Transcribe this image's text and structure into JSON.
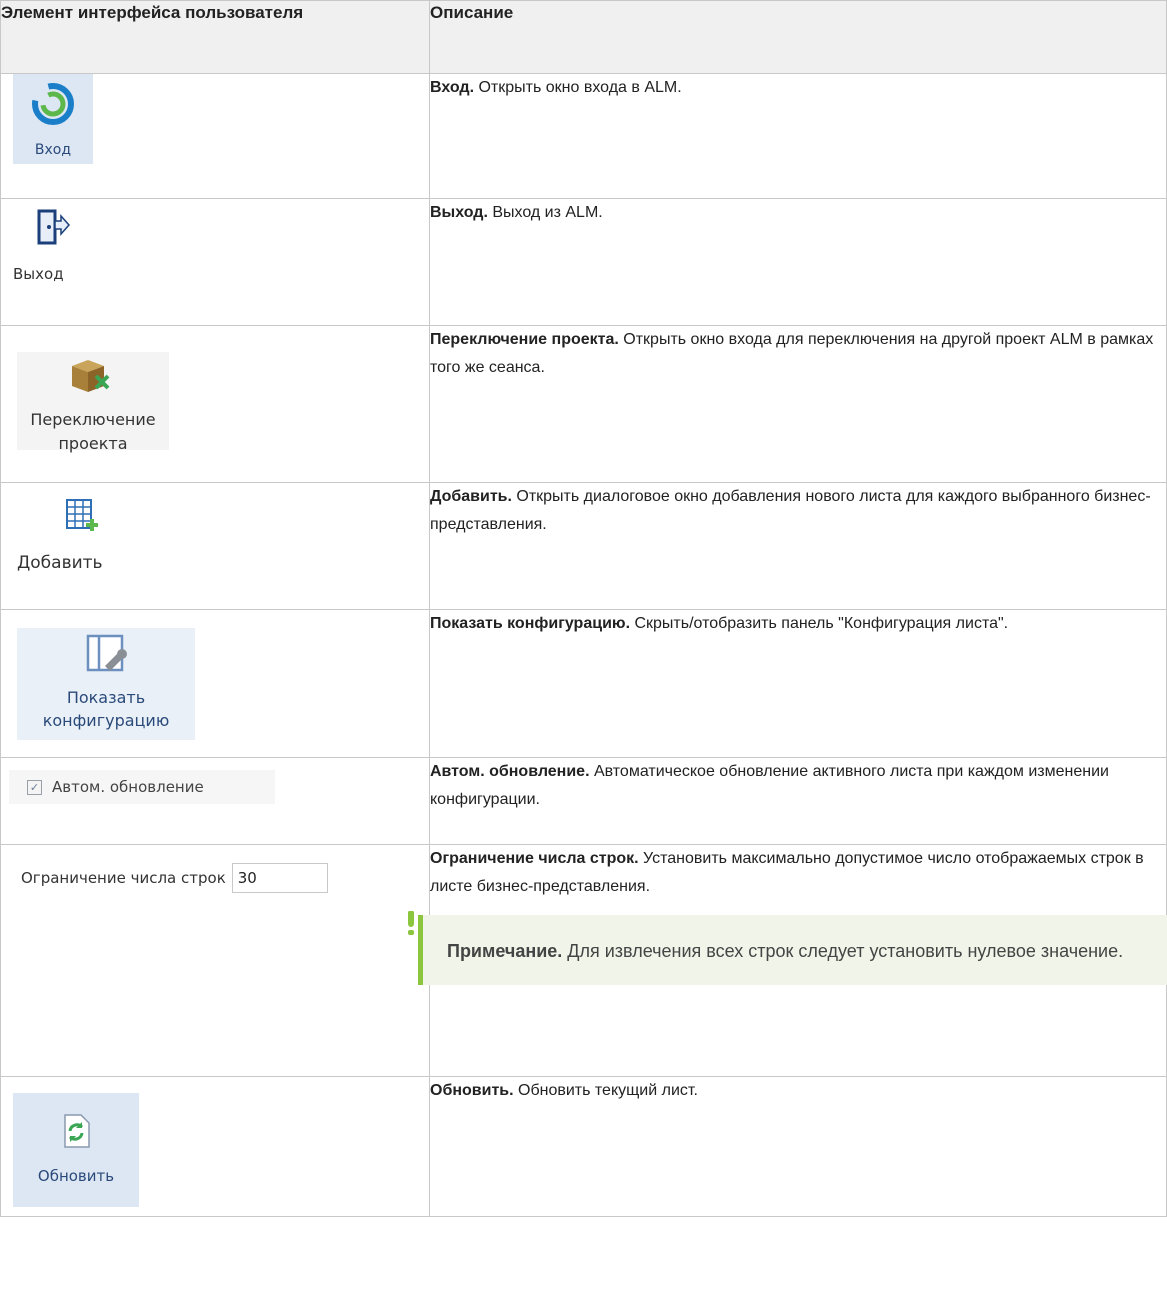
{
  "header": {
    "col1": "Элемент интерфейса пользователя",
    "col2": "Описание"
  },
  "rows": [
    {
      "icon_name": "alm-login-icon",
      "icon_label": "Вход",
      "title": "Вход.",
      "text": " Открыть окно входа в ALM."
    },
    {
      "icon_name": "logout-door-icon",
      "icon_label": "Выход",
      "title": "Выход.",
      "text": " Выход из ALM."
    },
    {
      "icon_name": "switch-project-box-icon",
      "icon_label": "Переключение проекта",
      "title": "Переключение проекта.",
      "text": " Открыть окно входа для переключения на другой проект ALM в рамках того же сеанса."
    },
    {
      "icon_name": "add-sheet-icon",
      "icon_label": "Добавить",
      "title": "Добавить.",
      "text": " Открыть диалоговое окно добавления нового листа для каждого выбранного бизнес-представления."
    },
    {
      "icon_name": "show-config-icon",
      "icon_label": "Показать конфигурацию",
      "title": "Показать конфигурацию.",
      "text": " Скрыть/отобразить панель \"Конфигурация листа\"."
    },
    {
      "icon_name": "checkbox-icon",
      "icon_label": "Автом. обновление",
      "checked": true,
      "title": "Автом. обновление.",
      "text": " Автоматическое обновление активного листа при каждом изменении конфигурации."
    },
    {
      "icon_name": "row-limit-input",
      "icon_label": "Ограничение числа строк",
      "input_value": "30",
      "title": "Ограничение числа строк.",
      "text": " Установить максимально допустимое число отображаемых строк в листе бизнес-представления.",
      "note_title": "Примечание.",
      "note_text": " Для извлечения всех строк следует установить нулевое значение."
    },
    {
      "icon_name": "refresh-icon",
      "icon_label": "Обновить",
      "title": "Обновить.",
      "text": " Обновить текущий лист."
    }
  ],
  "colors": {
    "header_bg": "#f0f0f0",
    "border": "#c8c8c8",
    "icon_highlight": "#dde7f4",
    "note_accent": "#8cc63e",
    "note_bg": "#f1f5e9"
  }
}
